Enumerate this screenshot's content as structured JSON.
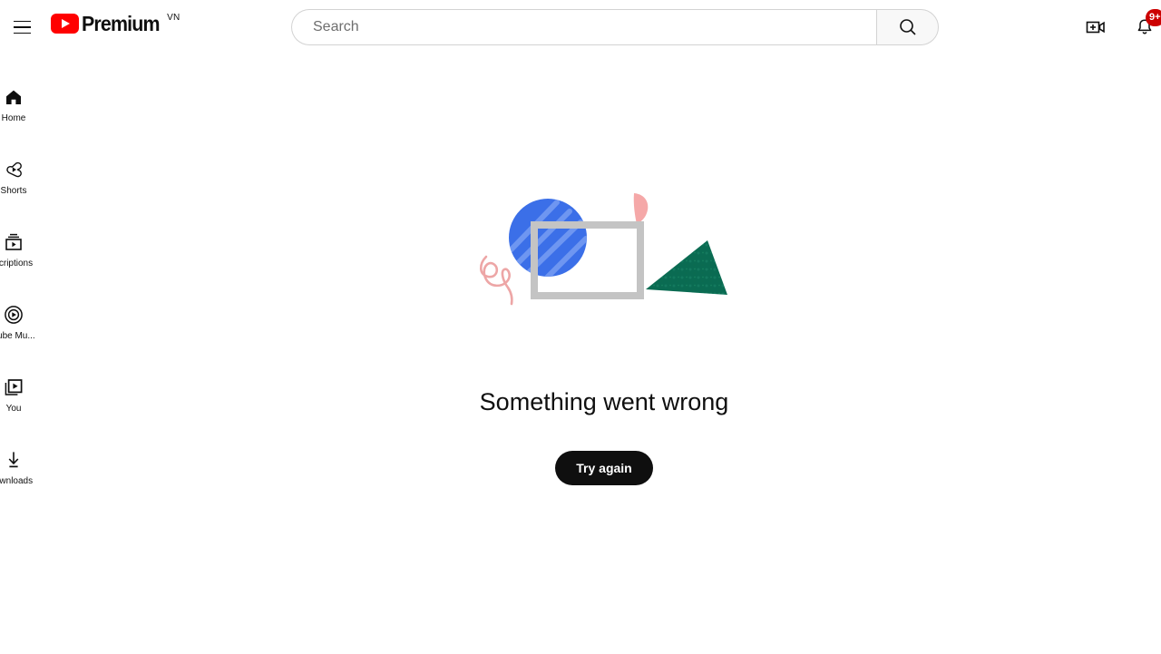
{
  "header": {
    "menu_icon": "hamburger-menu-icon",
    "logo": {
      "word": "Premium",
      "country_code": "VN",
      "brand_red": "#FF0000"
    },
    "search": {
      "placeholder": "Search",
      "value": "",
      "button_icon": "search-icon"
    },
    "create_icon": "create-video-icon",
    "notifications": {
      "icon": "bell-icon",
      "badge_count": "9+",
      "badge_color": "#CC0000"
    }
  },
  "sidebar": {
    "items": [
      {
        "label": "Home",
        "icon": "home-icon",
        "active": true
      },
      {
        "label": "Shorts",
        "icon": "shorts-icon",
        "active": false
      },
      {
        "label": "scriptions",
        "icon": "subscriptions-icon",
        "active": false
      },
      {
        "label": "Tube Mu...",
        "icon": "youtube-music-icon",
        "active": false
      },
      {
        "label": "You",
        "icon": "library-icon",
        "active": false
      },
      {
        "label": "ownloads",
        "icon": "downloads-icon",
        "active": false
      }
    ]
  },
  "main": {
    "error": {
      "title": "Something went wrong",
      "retry_label": "Try again",
      "illustration": {
        "name": "error-shapes-illustration",
        "shapes": [
          {
            "name": "blue-striped-circle",
            "color": "#3B6FE8",
            "stripe_color": "#6B95F0"
          },
          {
            "name": "gray-rectangle-frame",
            "color": "#C4C4C4"
          },
          {
            "name": "green-textured-triangle",
            "color": "#0A6B52"
          },
          {
            "name": "pink-petal",
            "color": "#F5A8A8"
          },
          {
            "name": "pink-squiggle",
            "color": "#EDA6A6"
          }
        ]
      }
    }
  }
}
